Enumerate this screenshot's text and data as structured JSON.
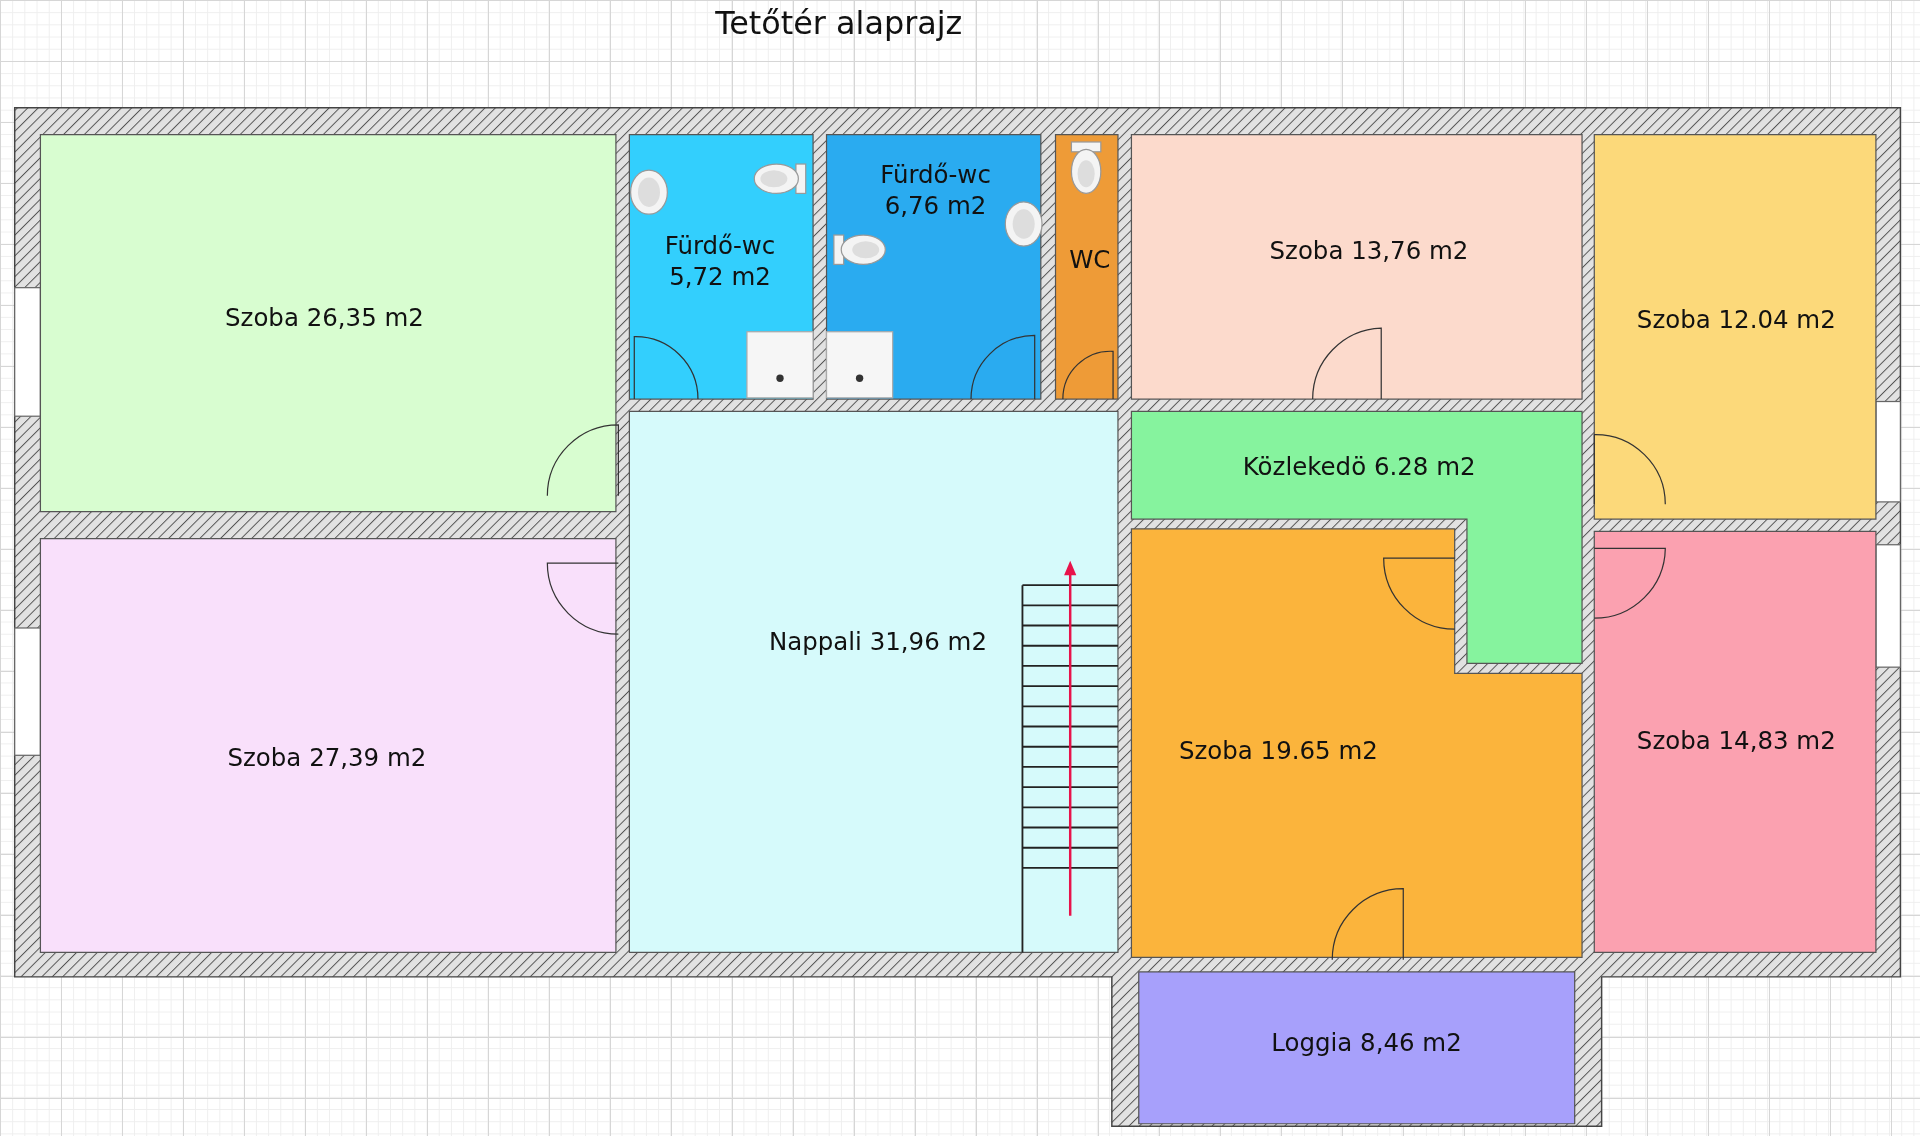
{
  "title": "Tetőtér alaprajz",
  "rooms": [
    {
      "lines": [
        "Szoba 26,35 m2"
      ],
      "color": "#d8fdd0"
    },
    {
      "lines": [
        "Szoba 27,39 m2"
      ],
      "color": "#f9e0fb"
    },
    {
      "lines": [
        "Fürdő-wc",
        "5,72 m2"
      ],
      "color": "#33cffd"
    },
    {
      "lines": [
        "Fürdő-wc",
        "6,76 m2"
      ],
      "color": "#2aabf0"
    },
    {
      "lines": [
        "WC"
      ],
      "color": "#ee9b37"
    },
    {
      "lines": [
        "Szoba 13,76 m2"
      ],
      "color": "#fcdacc"
    },
    {
      "lines": [
        "Szoba 12.04 m2"
      ],
      "color": "#fcd97a"
    },
    {
      "lines": [
        "Közlekedö 6.28 m2"
      ],
      "color": "#86f39e"
    },
    {
      "lines": [
        "Nappali 31,96 m2"
      ],
      "color": "#d6fafb"
    },
    {
      "lines": [
        "Szoba 19.65 m2"
      ],
      "color": "#fbb43c"
    },
    {
      "lines": [
        "Szoba 14,83 m2"
      ],
      "color": "#fba1b0"
    },
    {
      "lines": [
        "Loggia 8,46 m2"
      ],
      "color": "#a7a0fb"
    }
  ]
}
